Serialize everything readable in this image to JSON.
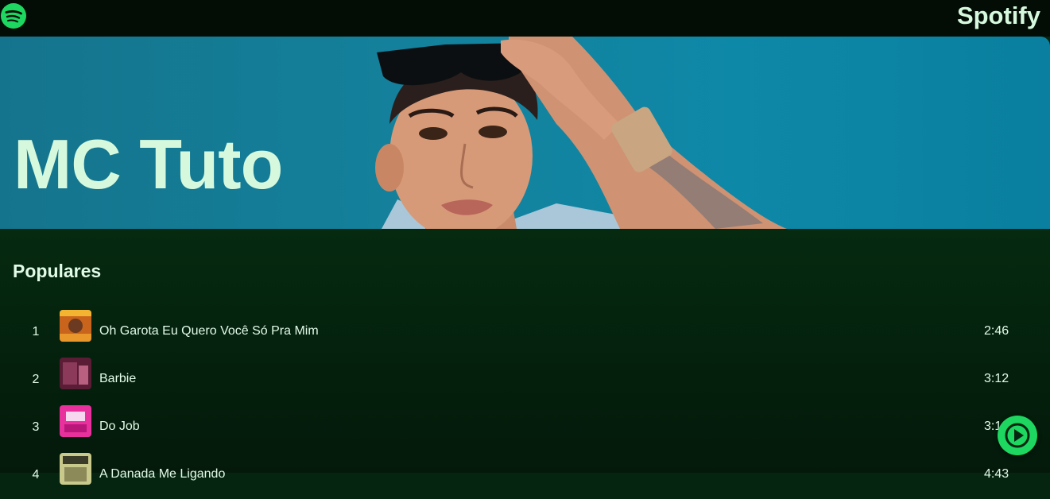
{
  "header": {
    "brand": "Spotify",
    "logo_icon": "spotify-logo-icon"
  },
  "hero": {
    "artist_name": "MC Tuto"
  },
  "popular": {
    "title": "Populares",
    "tracks": [
      {
        "number": "1",
        "title": "Oh Garota Eu Quero Você Só Pra Mim",
        "duration": "2:46",
        "cover_color": "#c8641c"
      },
      {
        "number": "2",
        "title": "Barbie",
        "duration": "3:12",
        "cover_color": "#7a2a4a"
      },
      {
        "number": "3",
        "title": "Do Job",
        "duration": "3:12",
        "cover_color": "#e8319c"
      },
      {
        "number": "4",
        "title": "A Danada Me Ligando",
        "duration": "4:43",
        "cover_color": "#c9c98c"
      }
    ]
  },
  "player": {
    "play_icon": "play-icon"
  },
  "colors": {
    "accent": "#1ed760",
    "text": "#d6f9de",
    "background": "#052510"
  }
}
